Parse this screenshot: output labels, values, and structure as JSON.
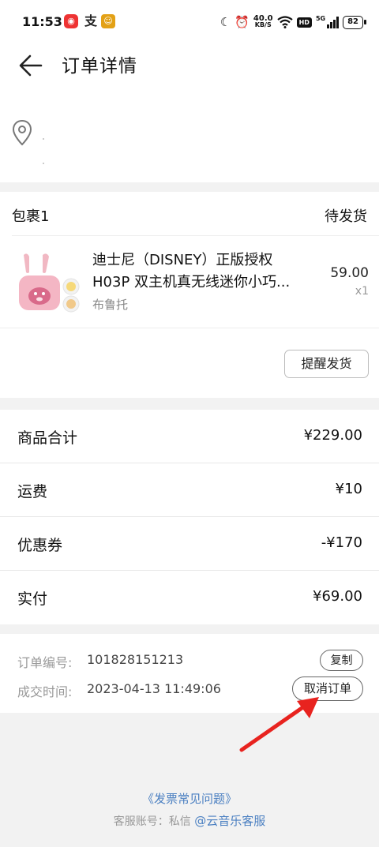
{
  "status_bar": {
    "time": "11:53",
    "apps": [
      "netease-music-icon",
      "alipay-icon",
      "game-icon"
    ],
    "net_speed_value": "40.0",
    "net_speed_unit": "KB/S",
    "hd_label": "HD",
    "network_label": "5G",
    "battery": "82"
  },
  "header": {
    "title": "订单详情",
    "back_icon": "arrow-left-icon"
  },
  "address": {
    "icon": "location-pin-icon"
  },
  "package": {
    "title": "包裹1",
    "status": "待发货",
    "product": {
      "name_line1": "迪士尼（DISNEY）正版授权",
      "name_line2": "H03P 双主机真无线迷你小巧...",
      "variant": "布鲁托",
      "price": "59.00",
      "quantity": "x1"
    },
    "remind_button": "提醒发货"
  },
  "summary": {
    "rows": [
      {
        "label": "商品合计",
        "value": "¥229.00"
      },
      {
        "label": "运费",
        "value": "¥10"
      },
      {
        "label": "优惠券",
        "value": "-¥170"
      },
      {
        "label": "实付",
        "value": "¥69.00"
      }
    ]
  },
  "order_info": {
    "order_no_label": "订单编号:",
    "order_no": "101828151213",
    "copy_button": "复制",
    "time_label": "成交时间:",
    "time_value": "2023-04-13 11:49:06",
    "cancel_button": "取消订单"
  },
  "footer": {
    "invoice_link": "《发票常见问题》",
    "cs_prefix": "客服账号：私信",
    "cs_link": "@云音乐客服"
  },
  "colors": {
    "link": "#4a7fc1",
    "annotation_arrow": "#e8231f",
    "background": "#f2f2f2"
  }
}
